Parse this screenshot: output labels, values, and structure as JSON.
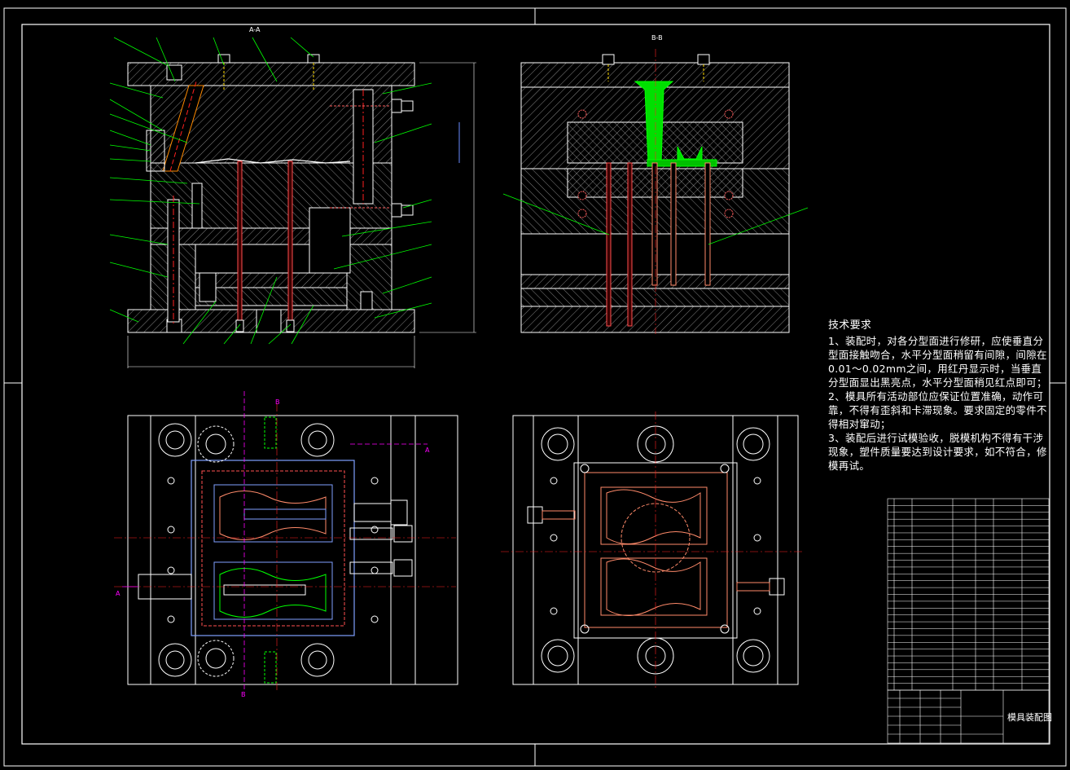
{
  "section_labels": {
    "aa": "A-A",
    "bb": "B-B"
  },
  "cut_markers": {
    "b": "B",
    "a": "A"
  },
  "tech_requirements": {
    "heading": "技术要求",
    "items": [
      "1、装配时，对各分型面进行修研，应使垂直分型面接触吻合，水平分型面稍留有间隙，间隙在0.01～0.02mm之间，用红丹显示时，当垂直分型面显出黑亮点，水平分型面稍见红点即可；",
      "2、模具所有活动部位应保证位置准确，动作可靠，不得有歪斜和卡滞现象。要求固定的零件不得相对窜动；",
      "3、装配后进行试模验收，脱模机构不得有干涉现象，塑件质量要达到设计要求，如不符合，修模再试。"
    ]
  },
  "title_block": {
    "title": "模具装配图"
  },
  "colors": {
    "background": "#000000",
    "outline": "#ffffff",
    "hatch": "#cfcfcf",
    "centerline": "#ff2020",
    "leader": "#00ff00",
    "cooling": "#ff6060",
    "cavity": "#ff8a6a",
    "insert_blue": "#7f9fff",
    "cut_marker": "#ff00ff",
    "sprue": "#00ff00",
    "dim": "#6a8cff"
  },
  "icons": [
    "bolt-icon",
    "water-nipple-icon",
    "guide-pillar-icon",
    "ejector-pin-icon"
  ]
}
